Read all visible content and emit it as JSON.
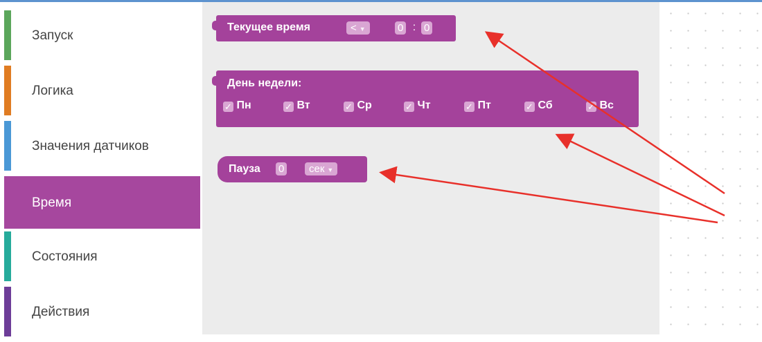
{
  "toolbox": {
    "categories": [
      {
        "label": "Запуск",
        "color": "#5ba65b"
      },
      {
        "label": "Логика",
        "color": "#e07c22"
      },
      {
        "label": "Значения датчиков",
        "color": "#4a98d6"
      },
      {
        "label": "Время",
        "color": "#a6479e"
      },
      {
        "label": "Состояния",
        "color": "#26ab9b"
      },
      {
        "label": "Действия",
        "color": "#6d3d98"
      }
    ],
    "selected": "Время"
  },
  "blocks": {
    "current_time": {
      "label": "Текущее время",
      "operator": "<",
      "hour": "0",
      "separator": ":",
      "minute": "0"
    },
    "weekday": {
      "label": "День недели:",
      "days": [
        {
          "name": "Пн",
          "checked": "✓"
        },
        {
          "name": "Вт",
          "checked": "✓"
        },
        {
          "name": "Ср",
          "checked": "✓"
        },
        {
          "name": "Чт",
          "checked": "✓"
        },
        {
          "name": "Пт",
          "checked": "✓"
        },
        {
          "name": "Сб",
          "checked": "✓"
        },
        {
          "name": "Вс",
          "checked": "✓"
        }
      ]
    },
    "pause": {
      "label": "Пауза",
      "value": "0",
      "unit": "сек"
    }
  },
  "colors": {
    "block": "#a4429b",
    "field": "#d9a6d3",
    "annotation_arrows": "#e8302a"
  }
}
